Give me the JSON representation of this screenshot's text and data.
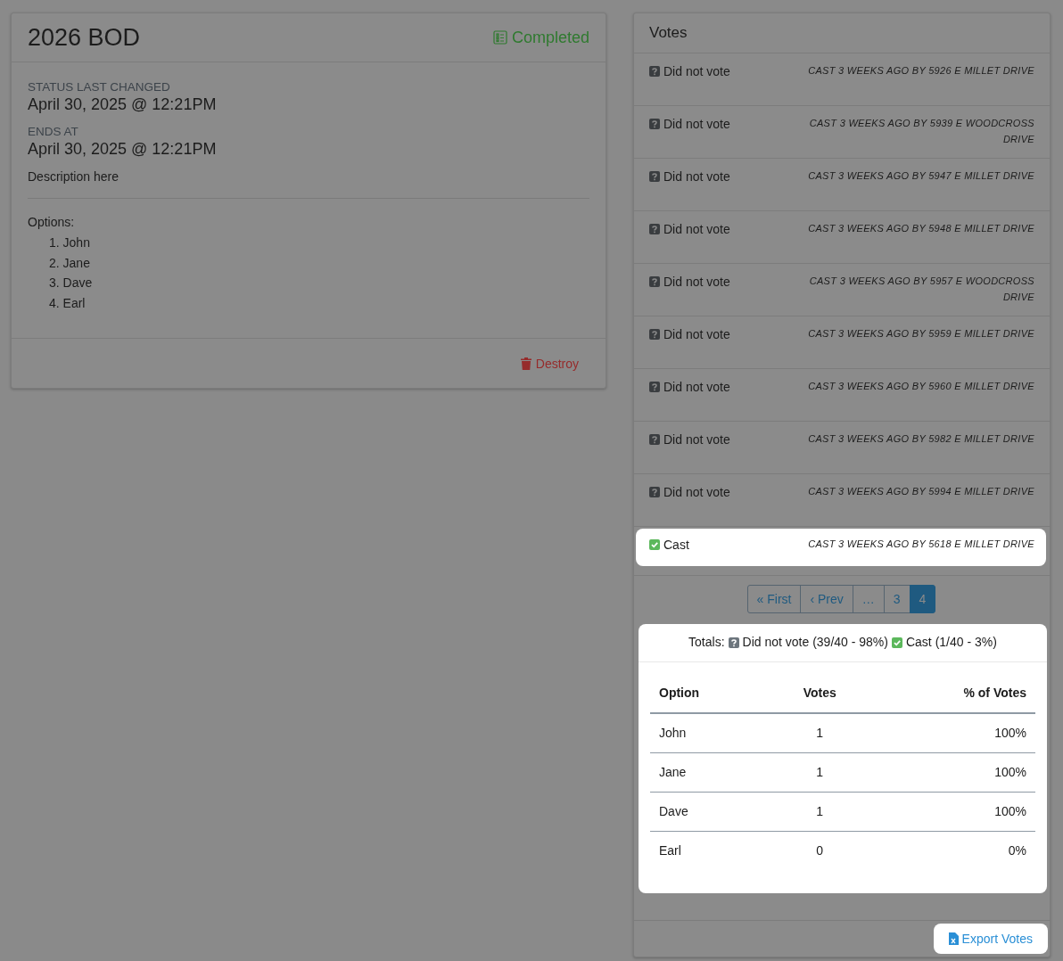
{
  "poll": {
    "title": "2026 BOD",
    "status": {
      "label": "Completed",
      "kind": "completed"
    },
    "fields": [
      {
        "label": "STATUS LAST CHANGED",
        "value": "April 30, 2025 @ 12:21PM"
      },
      {
        "label": "ENDS AT",
        "value": "April 30, 2025 @ 12:21PM"
      }
    ],
    "description": "Description here",
    "options_label": "Options:",
    "options": [
      {
        "number": "1.",
        "name": "John"
      },
      {
        "number": "2.",
        "name": "Jane"
      },
      {
        "number": "3.",
        "name": "Dave"
      },
      {
        "number": "4.",
        "name": "Earl"
      }
    ],
    "destroy_button": "Destroy"
  },
  "votes": {
    "title": "Votes",
    "items": [
      {
        "kind": "did_not_vote",
        "label": "Did not vote",
        "meta": [
          "CAST 3 WEEKS AGO BY 5926 E MILLET DRIVE"
        ],
        "highlighted": false
      },
      {
        "kind": "did_not_vote",
        "label": "Did not vote",
        "meta": [
          "CAST 3 WEEKS AGO BY 5939 E WOODCROSS",
          "DRIVE"
        ],
        "highlighted": false
      },
      {
        "kind": "did_not_vote",
        "label": "Did not vote",
        "meta": [
          "CAST 3 WEEKS AGO BY 5947 E MILLET DRIVE"
        ],
        "highlighted": false
      },
      {
        "kind": "did_not_vote",
        "label": "Did not vote",
        "meta": [
          "CAST 3 WEEKS AGO BY 5948 E MILLET DRIVE"
        ],
        "highlighted": false
      },
      {
        "kind": "did_not_vote",
        "label": "Did not vote",
        "meta": [
          "CAST 3 WEEKS AGO BY 5957 E WOODCROSS",
          "DRIVE"
        ],
        "highlighted": false
      },
      {
        "kind": "did_not_vote",
        "label": "Did not vote",
        "meta": [
          "CAST 3 WEEKS AGO BY 5959 E MILLET DRIVE"
        ],
        "highlighted": false
      },
      {
        "kind": "did_not_vote",
        "label": "Did not vote",
        "meta": [
          "CAST 3 WEEKS AGO BY 5960 E MILLET DRIVE"
        ],
        "highlighted": false
      },
      {
        "kind": "did_not_vote",
        "label": "Did not vote",
        "meta": [
          "CAST 3 WEEKS AGO BY 5982 E MILLET DRIVE"
        ],
        "highlighted": false
      },
      {
        "kind": "did_not_vote",
        "label": "Did not vote",
        "meta": [
          "CAST 3 WEEKS AGO BY 5994 E MILLET DRIVE"
        ],
        "highlighted": false
      },
      {
        "kind": "cast",
        "label": "Cast",
        "meta": [
          "CAST 3 WEEKS AGO BY 5618 E MILLET DRIVE"
        ],
        "highlighted": true
      }
    ],
    "pagination": [
      {
        "label": "« First",
        "selected": false
      },
      {
        "label": "‹ Prev",
        "selected": false
      },
      {
        "label": "…",
        "selected": false
      },
      {
        "label": "3",
        "selected": false
      },
      {
        "label": "4",
        "selected": true
      }
    ],
    "totals": {
      "highlighted": true,
      "label": "Totals:",
      "items": [
        {
          "kind": "did_not_vote",
          "text": "Did not vote (39/40 - 98%)"
        },
        {
          "kind": "cast",
          "text": "Cast (1/40 - 3%)"
        }
      ]
    },
    "table": {
      "columns": [
        "Option",
        "Votes",
        "% of Votes"
      ],
      "rows": [
        [
          "John",
          "1",
          "100%"
        ],
        [
          "Jane",
          "1",
          "100%"
        ],
        [
          "Dave",
          "1",
          "100%"
        ],
        [
          "Earl",
          "0",
          "0%"
        ]
      ]
    },
    "export_button": {
      "label": "Export Votes",
      "highlighted": true
    }
  }
}
